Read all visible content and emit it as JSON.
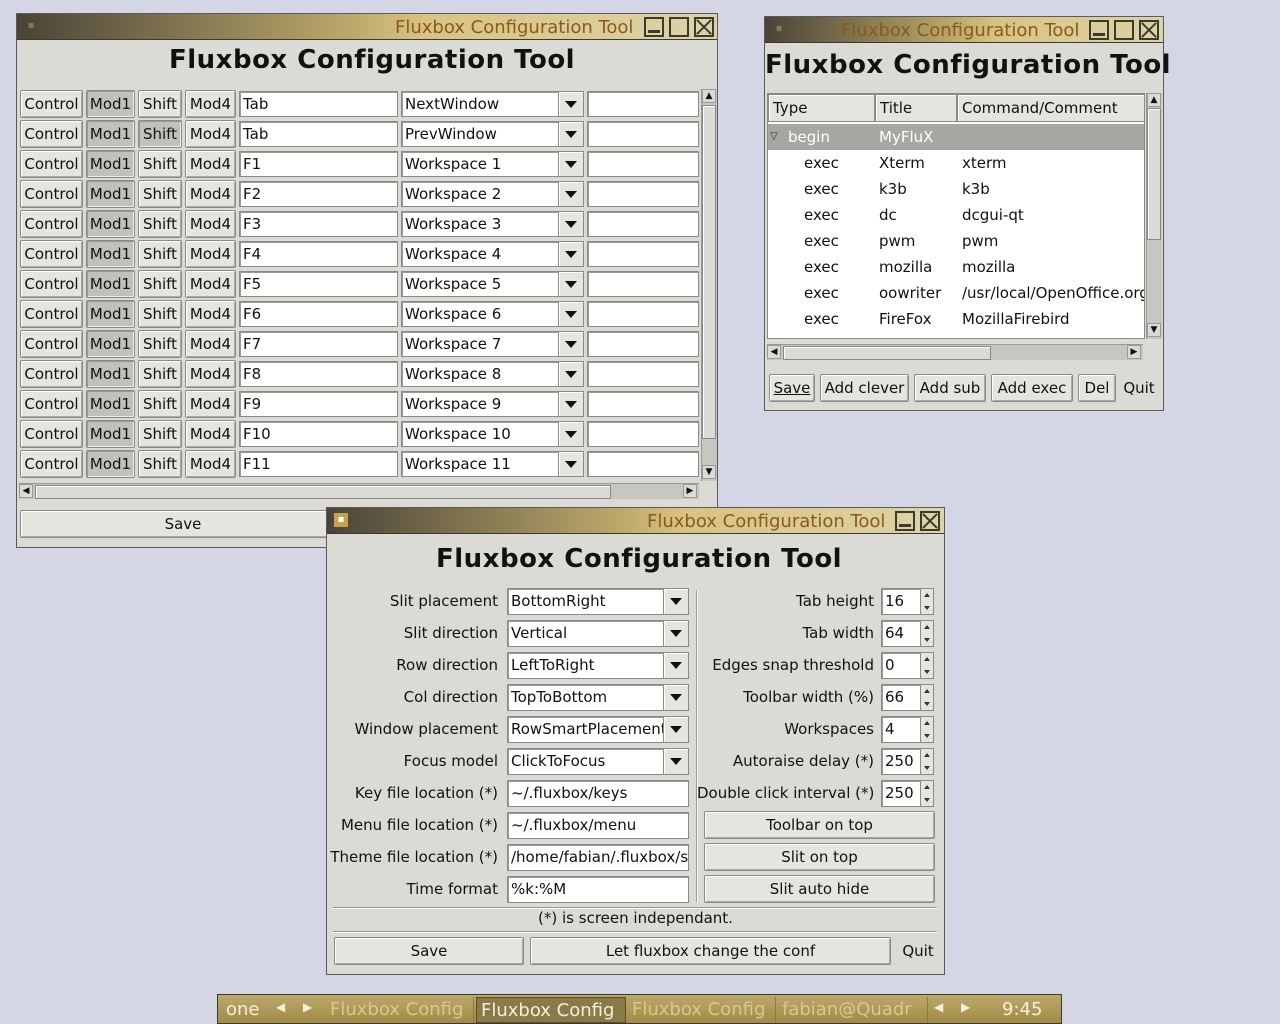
{
  "window_title": "Fluxbox Configuration Tool",
  "keys_window": {
    "heading": "Fluxbox Configuration Tool",
    "modifiers": [
      "Control",
      "Mod1",
      "Shift",
      "Mod4"
    ],
    "rows": [
      {
        "key": "Tab",
        "action": "NextWindow",
        "arg": "",
        "mod1": true,
        "shift": false
      },
      {
        "key": "Tab",
        "action": "PrevWindow",
        "arg": "",
        "mod1": true,
        "shift": true
      },
      {
        "key": "F1",
        "action": "Workspace 1",
        "arg": "",
        "mod1": true,
        "shift": false
      },
      {
        "key": "F2",
        "action": "Workspace 2",
        "arg": "",
        "mod1": true,
        "shift": false
      },
      {
        "key": "F3",
        "action": "Workspace 3",
        "arg": "",
        "mod1": true,
        "shift": false
      },
      {
        "key": "F4",
        "action": "Workspace 4",
        "arg": "",
        "mod1": true,
        "shift": false
      },
      {
        "key": "F5",
        "action": "Workspace 5",
        "arg": "",
        "mod1": true,
        "shift": false
      },
      {
        "key": "F6",
        "action": "Workspace 6",
        "arg": "",
        "mod1": true,
        "shift": false
      },
      {
        "key": "F7",
        "action": "Workspace 7",
        "arg": "",
        "mod1": true,
        "shift": false
      },
      {
        "key": "F8",
        "action": "Workspace 8",
        "arg": "",
        "mod1": true,
        "shift": false
      },
      {
        "key": "F9",
        "action": "Workspace 9",
        "arg": "",
        "mod1": true,
        "shift": false
      },
      {
        "key": "F10",
        "action": "Workspace 10",
        "arg": "",
        "mod1": true,
        "shift": false
      },
      {
        "key": "F11",
        "action": "Workspace 11",
        "arg": "",
        "mod1": true,
        "shift": false
      }
    ],
    "save_label": "Save"
  },
  "menu_window": {
    "heading": "Fluxbox Configuration Tool",
    "columns": [
      "Type",
      "Title",
      "Command/Comment"
    ],
    "rows": [
      {
        "type": "begin",
        "title": "MyFluX",
        "command": "",
        "selected": true
      },
      {
        "type": "exec",
        "title": "Xterm",
        "command": "xterm"
      },
      {
        "type": "exec",
        "title": "k3b",
        "command": "k3b"
      },
      {
        "type": "exec",
        "title": "dc",
        "command": "dcgui-qt"
      },
      {
        "type": "exec",
        "title": "pwm",
        "command": "pwm"
      },
      {
        "type": "exec",
        "title": "mozilla",
        "command": "mozilla"
      },
      {
        "type": "exec",
        "title": "oowriter",
        "command": "/usr/local/OpenOffice.org"
      },
      {
        "type": "exec",
        "title": "FireFox",
        "command": "MozillaFirebird"
      }
    ],
    "buttons": {
      "save": "Save",
      "add_clever": "Add clever",
      "add_sub": "Add sub",
      "add_exec": "Add exec",
      "del": "Del",
      "quit": "Quit"
    }
  },
  "settings_window": {
    "heading": "Fluxbox Configuration Tool",
    "left": [
      {
        "label": "Slit placement",
        "value": "BottomRight",
        "kind": "combo"
      },
      {
        "label": "Slit direction",
        "value": "Vertical",
        "kind": "combo"
      },
      {
        "label": "Row direction",
        "value": "LeftToRight",
        "kind": "combo"
      },
      {
        "label": "Col direction",
        "value": "TopToBottom",
        "kind": "combo"
      },
      {
        "label": "Window placement",
        "value": "RowSmartPlacement",
        "kind": "combo"
      },
      {
        "label": "Focus model",
        "value": "ClickToFocus",
        "kind": "combo"
      },
      {
        "label": "Key file location (*)",
        "value": "~/.fluxbox/keys",
        "kind": "entry"
      },
      {
        "label": "Menu file location (*)",
        "value": "~/.fluxbox/menu",
        "kind": "entry"
      },
      {
        "label": "Theme file location (*)",
        "value": "/home/fabian/.fluxbox/st",
        "kind": "entry"
      },
      {
        "label": "Time format",
        "value": "%k:%M",
        "kind": "entry"
      }
    ],
    "right": [
      {
        "label": "Tab height",
        "value": "16"
      },
      {
        "label": "Tab width",
        "value": "64"
      },
      {
        "label": "Edges snap threshold",
        "value": "0"
      },
      {
        "label": "Toolbar width (%)",
        "value": "66"
      },
      {
        "label": "Workspaces",
        "value": "4"
      },
      {
        "label": "Autoraise delay (*)",
        "value": "250"
      },
      {
        "label": "Double click interval (*)",
        "value": "250"
      }
    ],
    "toggles": [
      "Toolbar on top",
      "Slit on top",
      "Slit auto hide"
    ],
    "note": "(*) is screen independant.",
    "save_label": "Save",
    "let_label": "Let fluxbox change the conf",
    "quit_label": "Quit"
  },
  "taskbar": {
    "workspace": "one",
    "tasks": [
      "Fluxbox Config",
      "Fluxbox Config",
      "Fluxbox Config",
      "fabian@Quadr"
    ],
    "active_task": 1,
    "clock": "9:45"
  }
}
